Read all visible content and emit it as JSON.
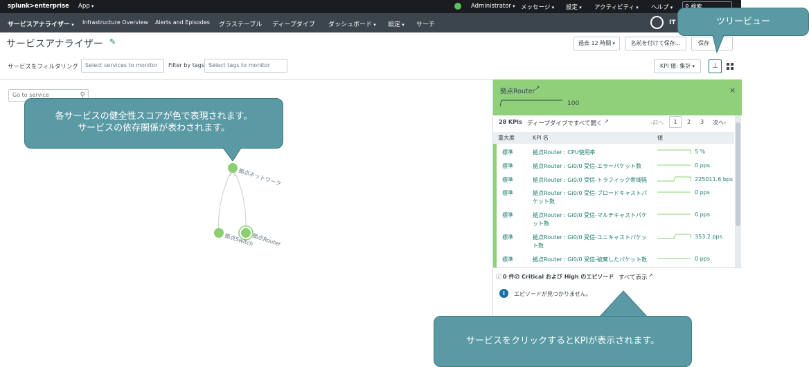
{
  "topbar": {
    "logo": "splunk>enterprise",
    "app": "App",
    "items": [
      "Administrator",
      "メッセージ",
      "設定",
      "アクティビティ",
      "ヘルプ"
    ],
    "search_placeholder": "検索"
  },
  "appbar": {
    "items": [
      {
        "label": "サービスアナライザー",
        "caret": true,
        "bold": true
      },
      {
        "label": "Infrastructure Overview"
      },
      {
        "label": "Alerts and Episodes"
      },
      {
        "label": "グラステーブル"
      },
      {
        "label": "ディープダイブ"
      },
      {
        "label": "ダッシュボード",
        "caret": true
      },
      {
        "label": "設定",
        "caret": true
      },
      {
        "label": "サーチ"
      }
    ],
    "brand": "IT S"
  },
  "page": {
    "title": "サービスアナライザー",
    "time_range": "過去 12 時間",
    "save_as": "名前を付けて保存...",
    "save": "保存",
    "filter_label": "サービスをフィルタリング",
    "services_placeholder": "Select services to monitor",
    "tags_label": "Filter by tags",
    "tags_placeholder": "Select tags to monitor",
    "kpi_value": "KPI 値: 集計"
  },
  "tree": {
    "go_to_placeholder": "Go to service",
    "nodes": [
      {
        "label": "拠点ネットワーク"
      },
      {
        "label": "拠点Switch"
      },
      {
        "label": "拠点Router"
      }
    ]
  },
  "panel": {
    "service": "拠点Router",
    "score": "100",
    "kpi_count": "28 KPIs",
    "deep_dive_link": "ディープダイブですべて開く",
    "prev": "‹前へ",
    "pages": [
      "1",
      "2",
      "3"
    ],
    "next": "次へ›",
    "col_severity": "重大度",
    "col_name": "KPI 名",
    "col_value": "値",
    "kpis": [
      {
        "sev": "標準",
        "name": "拠点Router : CPU使用率",
        "value": "5 %"
      },
      {
        "sev": "標準",
        "name": "拠点Router : Gi0/0 受信-エラーパケット数",
        "value": "0 pps"
      },
      {
        "sev": "標準",
        "name": "拠点Router : Gi0/0 受信-トラフィック帯域幅",
        "value": "225011.6 bps"
      },
      {
        "sev": "標準",
        "name": "拠点Router : Gi0/0 受信-ブロードキャストパケット数",
        "value": "0 pps"
      },
      {
        "sev": "標準",
        "name": "拠点Router : Gi0/0 受信-マルチキャストパケット数",
        "value": "0 pps"
      },
      {
        "sev": "標準",
        "name": "拠点Router : Gi0/0 受信-ユニキャストパケット数",
        "value": "353.2 pps"
      },
      {
        "sev": "標準",
        "name": "拠点Router : Gi0/0 受信-破棄したパケット数",
        "value": "0 pps"
      }
    ],
    "episodes_title": "0 件の Critical および High のエピソード",
    "episodes_link": "すべて表示",
    "episodes_empty": "エピソードが見つかりません。"
  },
  "callouts": {
    "tree_view": "ツリービュー",
    "health": "各サービスの健全性スコアが色で表現されます。\nサービスの依存関係が表わされます。",
    "click": "サービスをクリックするとKPIが表示されます。"
  },
  "colors": {
    "green": "#90d07a",
    "node": "#8ccf72",
    "callout": "#5a9aa4",
    "link": "#1a7d6f"
  }
}
